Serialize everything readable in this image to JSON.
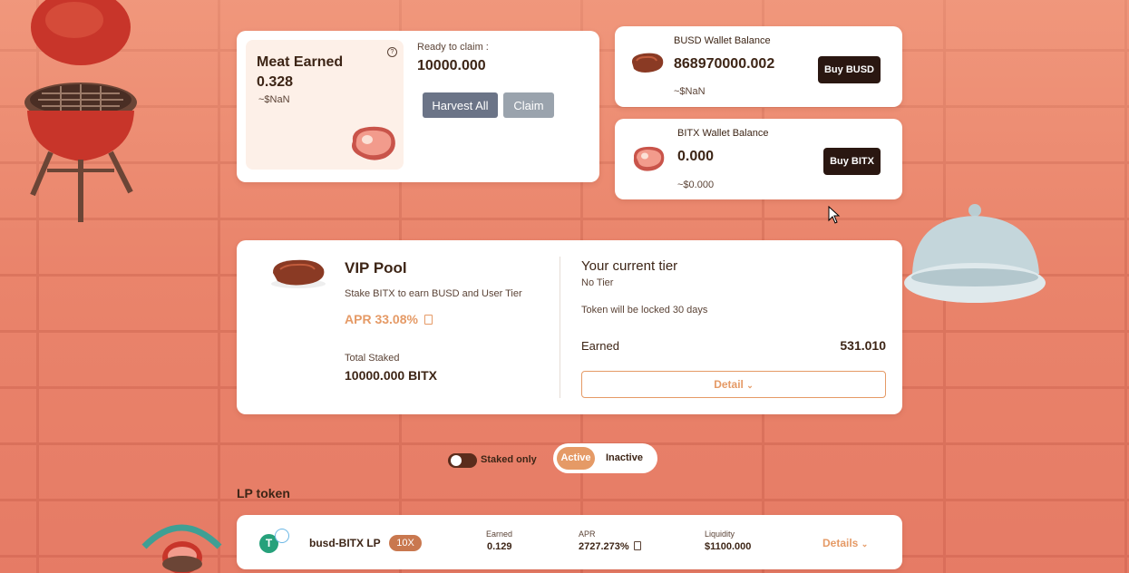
{
  "colors": {
    "accent": "#e59a66",
    "dark": "#2a1711",
    "grey_button": "#6b7487",
    "claim_button": "#9aa3ad"
  },
  "meat": {
    "title": "Meat Earned",
    "amount": "0.328",
    "usd": "~$NaN",
    "help_icon": "?",
    "ready_label": "Ready to claim :",
    "ready_value": "10000.000",
    "harvest_label": "Harvest All",
    "claim_label": "Claim"
  },
  "busd_wallet": {
    "label": "BUSD Wallet Balance",
    "amount": "868970000.002",
    "usd": "~$NaN",
    "buy_label": "Buy BUSD"
  },
  "bitx_wallet": {
    "label": "BITX Wallet Balance",
    "amount": "0.000",
    "usd": "~$0.000",
    "buy_label": "Buy BITX"
  },
  "vip": {
    "title": "VIP Pool",
    "desc": "Stake BITX to earn BUSD and User Tier",
    "apr": "APR 33.08%",
    "total_label": "Total Staked",
    "total_value": "10000.000 BITX",
    "tier_title": "Your current tier",
    "tier_value": "No Tier",
    "lock_text": "Token will be locked 30 days",
    "earned_label": "Earned",
    "earned_value": "531.010",
    "detail_label": "Detail"
  },
  "filters": {
    "staked_only": "Staked only",
    "active": "Active",
    "inactive": "Inactive"
  },
  "lp": {
    "section_title": "LP token",
    "name": "busd-BITX LP",
    "multiplier": "10X",
    "earned_label": "Earned",
    "earned_value": "0.129",
    "apr_label": "APR",
    "apr_value": "2727.273%",
    "liquidity_label": "Liquidity",
    "liquidity_value": "$1100.000",
    "details_label": "Details"
  }
}
